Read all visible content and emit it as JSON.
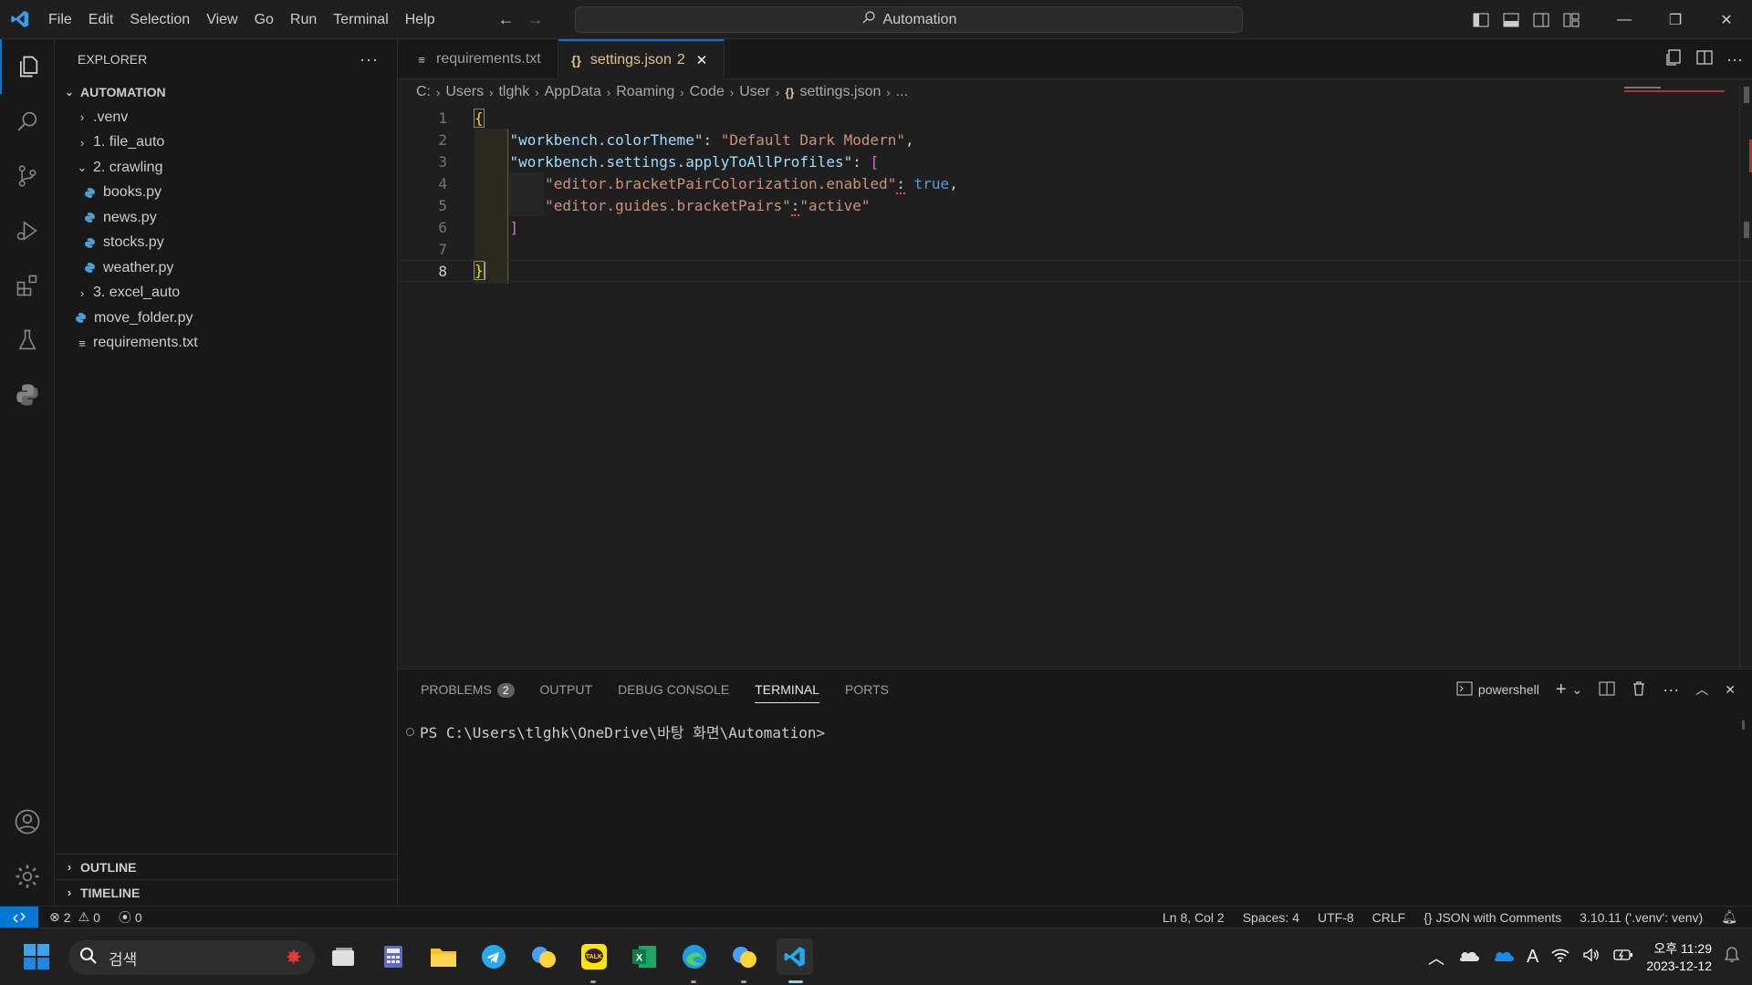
{
  "menu": [
    "File",
    "Edit",
    "Selection",
    "View",
    "Go",
    "Run",
    "Terminal",
    "Help"
  ],
  "command_center": "Automation",
  "sidebar": {
    "title": "EXPLORER",
    "folder": "AUTOMATION",
    "items": [
      {
        "label": ".venv",
        "type": "folder"
      },
      {
        "label": "1. file_auto",
        "type": "folder"
      },
      {
        "label": "2. crawling",
        "type": "folder-open"
      },
      {
        "label": "books.py",
        "type": "python"
      },
      {
        "label": "news.py",
        "type": "python"
      },
      {
        "label": "stocks.py",
        "type": "python"
      },
      {
        "label": "weather.py",
        "type": "python"
      },
      {
        "label": "3. excel_auto",
        "type": "folder"
      },
      {
        "label": "move_folder.py",
        "type": "python"
      },
      {
        "label": "requirements.txt",
        "type": "text"
      }
    ],
    "outline": "OUTLINE",
    "timeline": "TIMELINE"
  },
  "tabs": [
    {
      "label": "requirements.txt"
    },
    {
      "label": "settings.json",
      "problems": "2"
    }
  ],
  "breadcrumb": [
    "C:",
    "Users",
    "tlghk",
    "AppData",
    "Roaming",
    "Code",
    "User",
    "settings.json",
    "..."
  ],
  "code": {
    "line_numbers": [
      "1",
      "2",
      "3",
      "4",
      "5",
      "6",
      "7",
      "8"
    ],
    "l2_key": "\"workbench.colorTheme\"",
    "l2_val": "\"Default Dark Modern\"",
    "l3_key": "\"workbench.settings.applyToAllProfiles\"",
    "l4_key": "\"editor.bracketPairColorization.enabled\"",
    "l4_val": "true",
    "l5_key": "\"editor.guides.bracketPairs\"",
    "l5_val": "\"active\""
  },
  "panel": {
    "tabs": [
      "PROBLEMS",
      "OUTPUT",
      "DEBUG CONSOLE",
      "TERMINAL",
      "PORTS"
    ],
    "problems_count": "2",
    "shell": "powershell",
    "terminal_prompt": "PS C:\\Users\\tlghk\\OneDrive\\바탕 화면\\Automation>"
  },
  "status": {
    "errors": "2",
    "warnings": "0",
    "ports": "0",
    "position": "Ln 8, Col 2",
    "spaces": "Spaces: 4",
    "encoding": "UTF-8",
    "eol": "CRLF",
    "language": "JSON with Comments",
    "interpreter": "3.10.11 ('.venv': venv)"
  },
  "taskbar": {
    "search_placeholder": "검색",
    "time": "오후 11:29",
    "date": "2023-12-12",
    "ime": "A"
  },
  "colors": {
    "accent": "#0078d4",
    "modified_tab": "#e2c08d",
    "bracket_gold": "#ffd700",
    "bracket_purple": "#da70d6"
  }
}
